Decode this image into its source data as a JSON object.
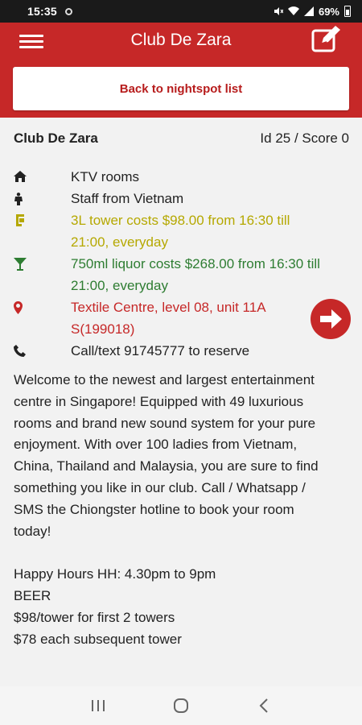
{
  "status_bar": {
    "time": "15:35",
    "battery": "69%"
  },
  "app_bar": {
    "title": "Club De Zara",
    "back_label": "Back to nightspot list"
  },
  "venue": {
    "name": "Club De Zara",
    "id_score": "Id 25 / Score 0",
    "details": [
      {
        "icon": "home-icon",
        "text": "KTV rooms",
        "color": "#222222"
      },
      {
        "icon": "person-icon",
        "text": "Staff from Vietnam",
        "color": "#222222"
      },
      {
        "icon": "beer-tower-icon",
        "text": "3L tower costs $98.00 from 16:30 till 21:00, everyday",
        "color": "#b5a800"
      },
      {
        "icon": "cocktail-icon",
        "text": "750ml liquor costs $268.00 from 16:30 till 21:00, everyday",
        "color": "#2e7d32"
      },
      {
        "icon": "map-marker-icon",
        "text": "Textile Centre, level 08, unit 11A S(199018)",
        "color": "#c62828"
      },
      {
        "icon": "phone-icon",
        "text": "Call/text 91745777 to reserve",
        "color": "#222222"
      }
    ],
    "description": "Welcome to the newest and largest entertainment centre in Singapore! Equipped with 49 luxurious rooms and brand new sound system for your pure enjoyment. With over 100 ladies from Vietnam, China, Thailand and Malaysia, you are sure to find something you like in our club. Call / Whatsapp / SMS the Chiongster hotline to book your room today!",
    "happy_hours": [
      "Happy Hours HH: 4.30pm to 9pm",
      "BEER",
      "$98/tower for first 2 towers",
      "$78 each subsequent tower"
    ]
  },
  "colors": {
    "brand": "#c62828",
    "accent_olive": "#b5a800",
    "accent_green": "#2e7d32"
  }
}
